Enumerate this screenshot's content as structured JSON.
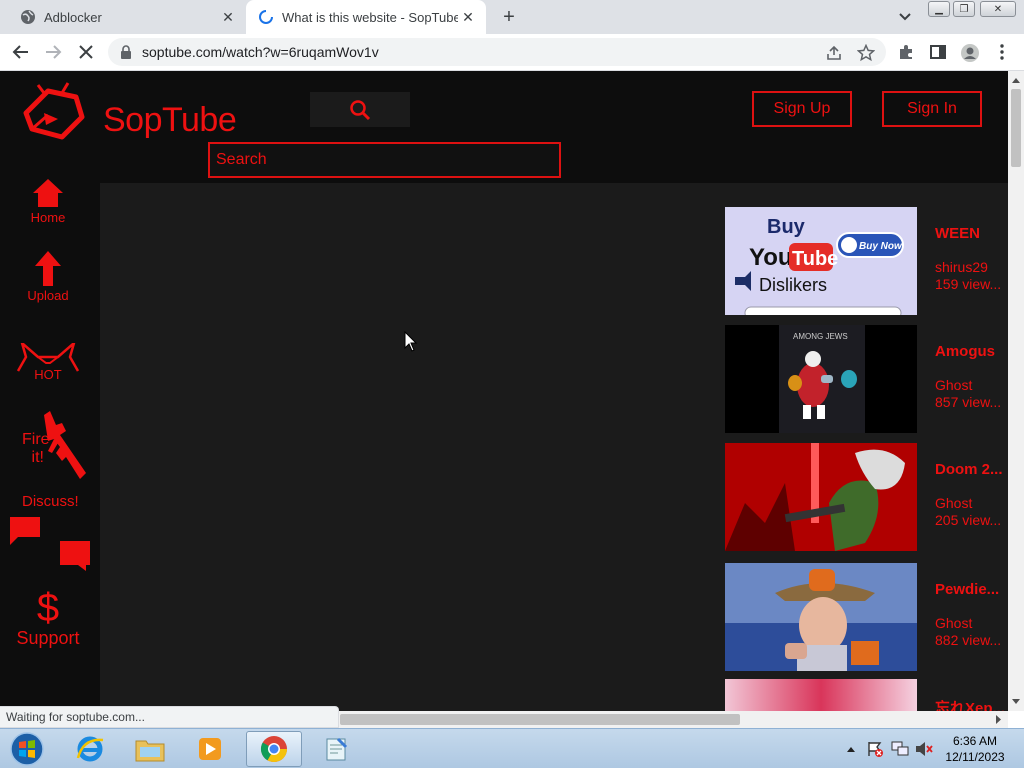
{
  "browser": {
    "tabs": [
      {
        "title": "Adblocker",
        "active": false
      },
      {
        "title": "What is this website - SopTube",
        "active": true
      }
    ],
    "url": "soptube.com/watch?w=6ruqamWov1v",
    "status": "Waiting for soptube.com..."
  },
  "site": {
    "logo_text": "SopTube",
    "search_placeholder": "Search",
    "sign_up": "Sign Up",
    "sign_in": "Sign In",
    "accent": "#e11111"
  },
  "sidebar": {
    "home": "Home",
    "upload": "Upload",
    "hot": "HOT",
    "fire_line1": "Fire",
    "fire_line2": "it!",
    "discuss": "Discuss!",
    "support_symbol": "$",
    "support": "Support"
  },
  "videos": [
    {
      "title": "WEEN",
      "user": "shirus29",
      "views": "159 view..."
    },
    {
      "title": "Amogus",
      "user": "Ghost",
      "views": "857 view..."
    },
    {
      "title": "Doom 2...",
      "user": "Ghost",
      "views": "205 view..."
    },
    {
      "title": "Pewdie...",
      "user": "Ghost",
      "views": "882 view..."
    },
    {
      "title": "忘れXep..."
    }
  ],
  "thumbnails": {
    "buy_word": "Buy",
    "you": "You",
    "tube": "Tube",
    "dislikers": "Dislikers",
    "buy_now": "Buy Now",
    "among_jews": "AMONG JEWS"
  },
  "taskbar": {
    "time": "6:36 AM",
    "date": "12/11/2023"
  }
}
